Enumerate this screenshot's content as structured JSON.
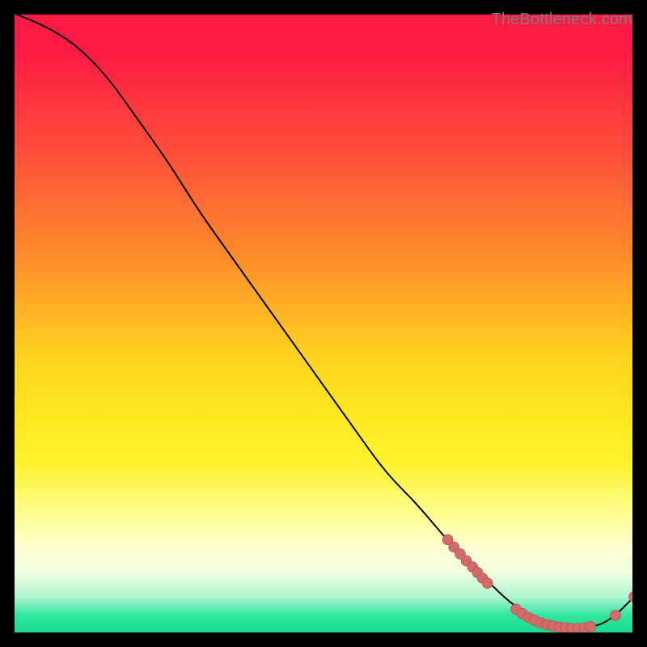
{
  "attribution": "TheBottleneck.com",
  "colors": {
    "gradient_top": "#ff1a44",
    "gradient_mid": "#ffe820",
    "gradient_bottom": "#18d98f",
    "curve_stroke": "#000000",
    "point_fill": "#d46a6a",
    "point_stroke": "#b14e4e"
  },
  "chart_data": {
    "type": "line",
    "title": "",
    "xlabel": "",
    "ylabel": "",
    "xlim": [
      0,
      100
    ],
    "ylim": [
      0,
      100
    ],
    "grid": false,
    "legend": false,
    "note": "Axes are unlabeled; values are normalized 0–100 from plot extents. Curve descends from top-left toward bottom-right, bottoms out near x≈90, then rises slightly.",
    "curve": {
      "x": [
        0,
        5,
        10,
        15,
        20,
        25,
        30,
        35,
        40,
        45,
        50,
        55,
        60,
        65,
        70,
        75,
        80,
        84,
        88,
        92,
        96,
        100
      ],
      "y": [
        100,
        98,
        95,
        90,
        83,
        76,
        68,
        61,
        54,
        47,
        40,
        33,
        26,
        21,
        15,
        10,
        5,
        2.5,
        1.0,
        0.8,
        2.0,
        6.0
      ]
    },
    "points_cluster_a": {
      "note": "Run of coral dots along the descending segment around x≈70–76",
      "x": [
        70.0,
        71.0,
        72.0,
        73.0,
        74.0,
        74.8,
        75.6,
        76.4
      ],
      "y": [
        15.2,
        14.0,
        12.9,
        11.8,
        10.8,
        9.9,
        9.0,
        8.2
      ]
    },
    "points_cluster_b": {
      "note": "Run of coral dots near the trough around x≈81–93 plus two on the upturn",
      "x": [
        81.0,
        82.0,
        83.0,
        84.0,
        85.0,
        86.0,
        87.0,
        88.0,
        89.0,
        90.0,
        91.0,
        92.0,
        93.0,
        97.0,
        100.0
      ],
      "y": [
        4.0,
        3.3,
        2.7,
        2.2,
        1.8,
        1.5,
        1.3,
        1.1,
        1.0,
        0.9,
        0.9,
        1.0,
        1.2,
        3.0,
        6.0
      ]
    }
  }
}
